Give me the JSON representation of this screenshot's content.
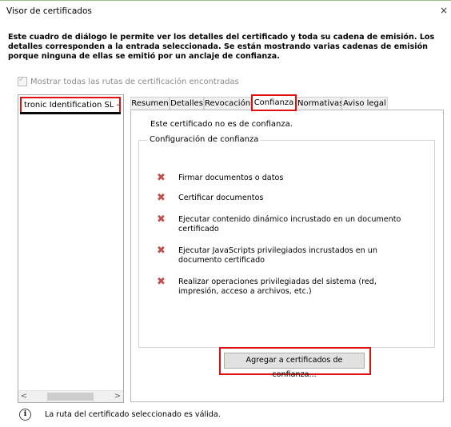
{
  "window": {
    "title": "Visor de certificados",
    "close_glyph": "×"
  },
  "intro_text": "Este cuadro de diálogo le permite ver los detalles del certificado y toda su cadena de emisión. Los detalles corresponden a la entrada seleccionada. Se están mostrando varias cadenas de emisión porque ninguna de ellas se emitió por un anclaje de confianza.",
  "show_all": {
    "label": "Mostrar todas las rutas de certificación encontradas",
    "checked": true
  },
  "tree": {
    "items": [
      {
        "label": "tronic Identification SL - RA"
      }
    ]
  },
  "scroll": {
    "left_arrow": "<",
    "right_arrow": ">"
  },
  "tabs": [
    {
      "label": "Resumen",
      "active": false
    },
    {
      "label": "Detalles",
      "active": false
    },
    {
      "label": "Revocación",
      "active": false
    },
    {
      "label": "Confianza",
      "active": true
    },
    {
      "label": "Normativas",
      "active": false
    },
    {
      "label": "Aviso legal",
      "active": false
    }
  ],
  "trust": {
    "status": "Este certificado no es de confianza.",
    "group_label": "Configuración de confianza",
    "permissions": [
      {
        "icon": "red-x-icon",
        "text": "Firmar documentos o datos"
      },
      {
        "icon": "red-x-icon",
        "text": "Certificar documentos"
      },
      {
        "icon": "red-x-icon",
        "text": "Ejecutar contenido dinámico incrustado en un documento certificado"
      },
      {
        "icon": "red-x-icon",
        "text": "Ejecutar JavaScripts privilegiados incrustados en un documento certificado"
      },
      {
        "icon": "red-x-icon",
        "text": "Realizar operaciones privilegiadas del sistema (red, impresión, acceso a archivos, etc.)"
      }
    ],
    "add_button": "Agregar a certificados de confianza..."
  },
  "footer": {
    "icon": "info-icon",
    "text": "La ruta del certificado seleccionado es válida."
  },
  "colors": {
    "highlight": "#e01010",
    "x_mark": "#c0504d"
  }
}
